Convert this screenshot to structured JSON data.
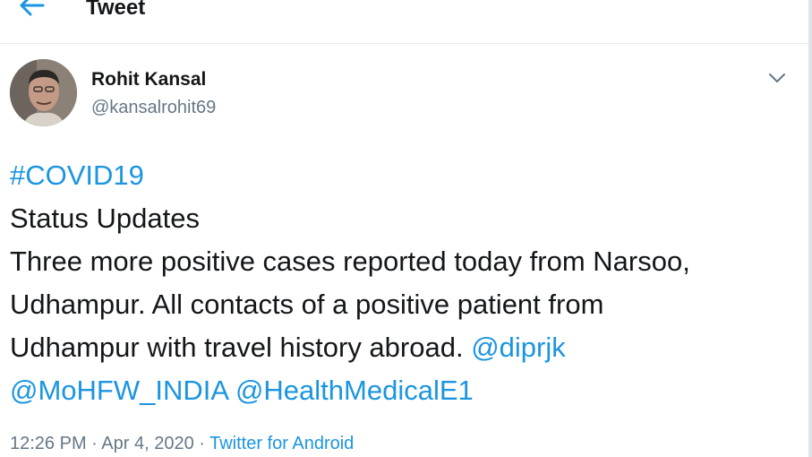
{
  "header": {
    "title": "Tweet",
    "back_icon": "back-arrow-icon",
    "accent_color": "#1b95e0"
  },
  "tweet": {
    "author_name": "Rohit Kansal",
    "author_handle": "@kansalrohit69",
    "hashtag": "#COVID19",
    "line1": "Status Updates",
    "line2": "Three more positive cases reported today from Narsoo,",
    "line3": "Udhampur. All contacts of a positive  patient from",
    "line4": "Udhampur with travel history abroad. ",
    "mention1": "@diprjk",
    "mention2": "@MoHFW_INDIA",
    "mention3": "@HealthMedicalE1",
    "time": "12:26 PM",
    "separator1": " · ",
    "date": "Apr 4, 2020",
    "separator2": " · ",
    "source": "Twitter for Android",
    "more_icon": "chevron-down-icon"
  }
}
